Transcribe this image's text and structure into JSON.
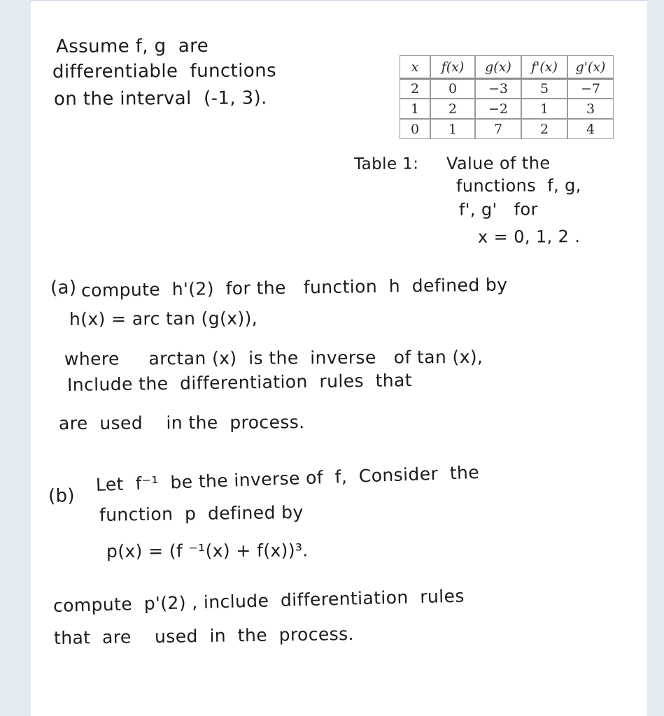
{
  "page": {
    "background_color": "#e4eaf2",
    "sheet_color": "#ffffff"
  },
  "preamble": {
    "line1": "Assume f, g  are",
    "line2": "differentiable  functions",
    "line3": "on the interval  (-1, 3)."
  },
  "table": {
    "headers": [
      "x",
      "f(x)",
      "g(x)",
      "f'(x)",
      "g'(x)"
    ],
    "rows": [
      [
        "2",
        "0",
        "−3",
        "5",
        "−7"
      ],
      [
        "1",
        "2",
        "−2",
        "1",
        "3"
      ],
      [
        "0",
        "1",
        "7",
        "2",
        "4"
      ]
    ],
    "caption": {
      "label": "Table 1:",
      "line1": "Value of the",
      "line2": "functions  f, g,",
      "line3": "f', g'   for",
      "line4": "x = 0, 1, 2 ."
    }
  },
  "parts": [
    {
      "marker": "(a)",
      "lines": [
        "compute  h'(2)  for the   function  h  defined by",
        "h(x) = arc tan (g(x)),",
        "where     arctan (x)  is the  inverse   of tan (x),",
        "Include the  differentiation  rules  that",
        "are  used    in the  process."
      ]
    },
    {
      "marker": "(b)",
      "lines": [
        "Let  f⁻¹  be the inverse of  f,  Consider  the",
        "function  p  defined by",
        "p(x) = (f ⁻¹(x) + f(x))³.",
        "compute  p'(2) , include  differentiation  rules",
        "that  are    used  in  the  process."
      ]
    }
  ]
}
